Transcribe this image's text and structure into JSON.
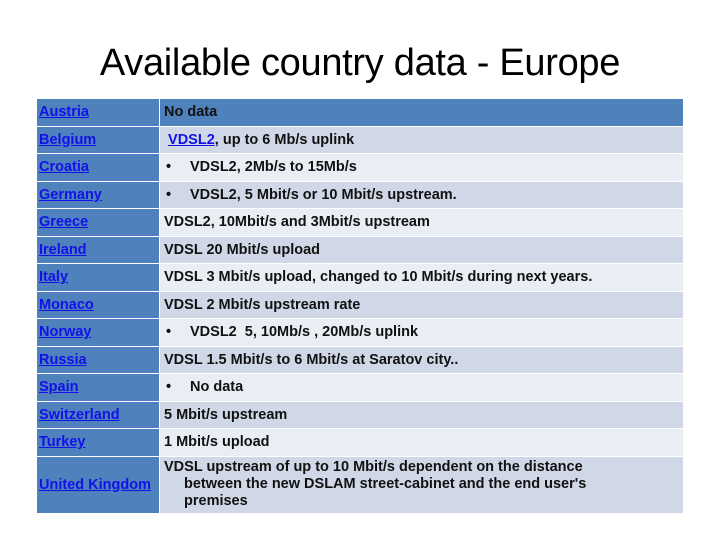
{
  "title": "Available country data - Europe",
  "colors": {
    "header_blue": "#4f81bd",
    "row_odd": "#d0d8e8",
    "row_even": "#e9edf4",
    "link": "#1212e8"
  },
  "rows": [
    {
      "country": "Austria",
      "info": "No data",
      "bullet": false
    },
    {
      "country": "Belgium",
      "info_link": "VDSL2",
      "info": ", up to 6 Mb/s uplink",
      "bullet": false
    },
    {
      "country": "Croatia",
      "info": "VDSL2, 2Mb/s to 15Mb/s",
      "bullet": true
    },
    {
      "country": "Germany",
      "info": "VDSL2, 5 Mbit/s or 10 Mbit/s upstream.",
      "bullet": true
    },
    {
      "country": "Greece",
      "info": "VDSL2, 10Mbit/s and 3Mbit/s upstream",
      "bullet": false
    },
    {
      "country": "Ireland",
      "info": "VDSL 20 Mbit/s upload",
      "bullet": false
    },
    {
      "country": "Italy",
      "info": "VDSL 3 Mbit/s upload, changed to 10 Mbit/s during next years.",
      "bullet": false
    },
    {
      "country": "Monaco",
      "info": "VDSL 2 Mbit/s upstream rate",
      "bullet": false
    },
    {
      "country": "Norway",
      "info": "VDSL2  5, 10Mb/s , 20Mb/s uplink",
      "bullet": true
    },
    {
      "country": "Russia",
      "info": "VDSL 1.5 Mbit/s to 6 Mbit/s at Saratov city..",
      "bullet": false
    },
    {
      "country": "Spain",
      "info": "No data",
      "bullet": true
    },
    {
      "country": "Switzerland",
      "info": "5 Mbit/s upstream",
      "bullet": false
    },
    {
      "country": "Turkey",
      "info": "1 Mbit/s upload",
      "bullet": false
    },
    {
      "country": "United Kingdom",
      "info_lines": [
        "VDSL upstream of up to 10 Mbit/s dependent on the distance",
        "between the new DSLAM street-cabinet and the end user's",
        "premises"
      ],
      "bullet": false
    }
  ],
  "bullet_glyph": "•"
}
